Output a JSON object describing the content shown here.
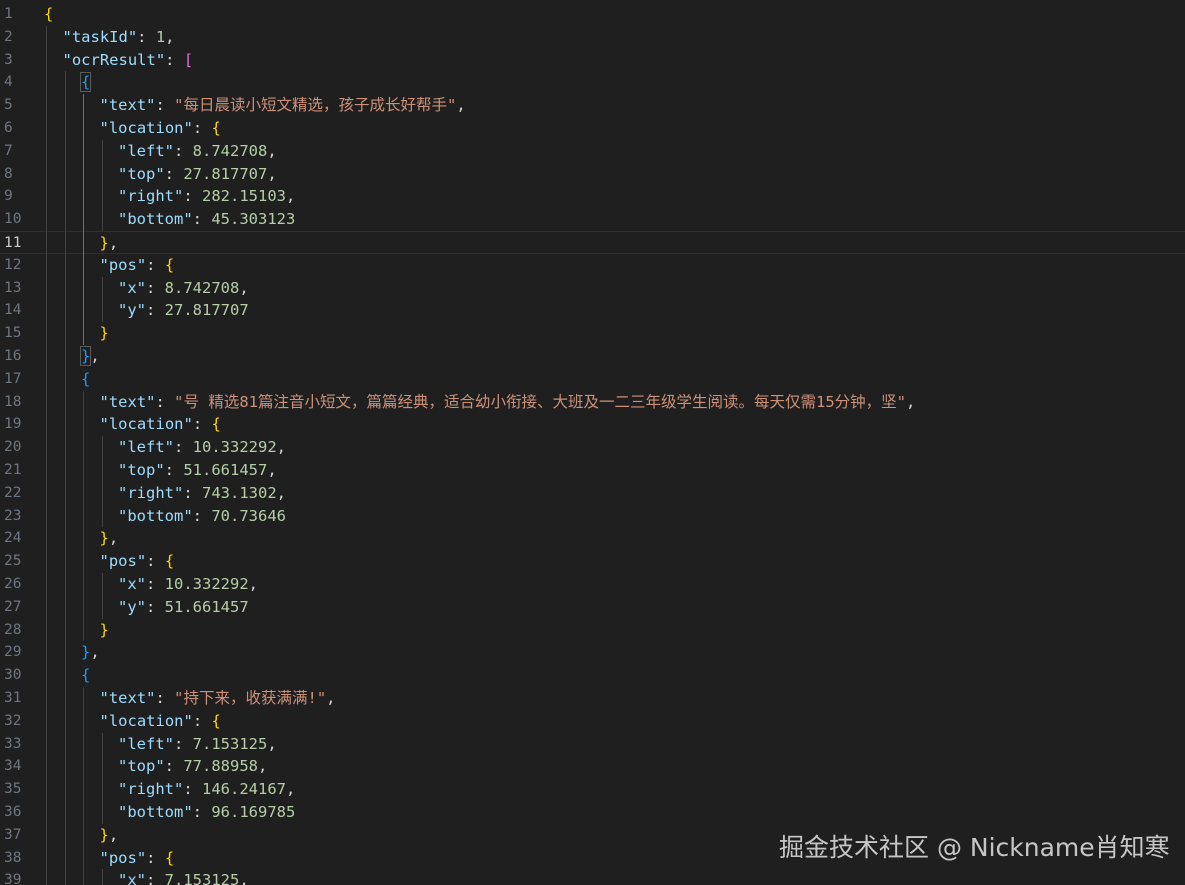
{
  "editor": {
    "theme": {
      "background": "#1f1f1f",
      "key": "#9cdcfe",
      "string": "#ce9178",
      "number": "#b5cea8",
      "bracket_l1": "#ffd700",
      "bracket_l2": "#da70d6",
      "bracket_l3": "#179fff"
    },
    "current_line": 11,
    "lines": [
      {
        "n": "1",
        "code": [
          [
            "b1",
            "{"
          ]
        ]
      },
      {
        "n": "2",
        "code": [
          [
            "k",
            "\"taskId\""
          ],
          [
            "p",
            ": "
          ],
          [
            "n",
            "1"
          ],
          [
            "p",
            ","
          ]
        ]
      },
      {
        "n": "3",
        "code": [
          [
            "k",
            "\"ocrResult\""
          ],
          [
            "p",
            ": "
          ],
          [
            "b2",
            "["
          ]
        ]
      },
      {
        "n": "4",
        "code": [
          [
            "b3 bm",
            "{"
          ]
        ]
      },
      {
        "n": "5",
        "code": [
          [
            "k",
            "\"text\""
          ],
          [
            "p",
            ": "
          ],
          [
            "s",
            "\"每日晨读小短文精选，孩子成长好帮手\""
          ],
          [
            "p",
            ","
          ]
        ]
      },
      {
        "n": "6",
        "code": [
          [
            "k",
            "\"location\""
          ],
          [
            "p",
            ": "
          ],
          [
            "b1",
            "{"
          ]
        ]
      },
      {
        "n": "7",
        "code": [
          [
            "k",
            "\"left\""
          ],
          [
            "p",
            ": "
          ],
          [
            "n",
            "8.742708"
          ],
          [
            "p",
            ","
          ]
        ]
      },
      {
        "n": "8",
        "code": [
          [
            "k",
            "\"top\""
          ],
          [
            "p",
            ": "
          ],
          [
            "n",
            "27.817707"
          ],
          [
            "p",
            ","
          ]
        ]
      },
      {
        "n": "9",
        "code": [
          [
            "k",
            "\"right\""
          ],
          [
            "p",
            ": "
          ],
          [
            "n",
            "282.15103"
          ],
          [
            "p",
            ","
          ]
        ]
      },
      {
        "n": "10",
        "code": [
          [
            "k",
            "\"bottom\""
          ],
          [
            "p",
            ": "
          ],
          [
            "n",
            "45.303123"
          ]
        ]
      },
      {
        "n": "11",
        "code": [
          [
            "b1",
            "}"
          ],
          [
            "p",
            ","
          ]
        ]
      },
      {
        "n": "12",
        "code": [
          [
            "k",
            "\"pos\""
          ],
          [
            "p",
            ": "
          ],
          [
            "b1",
            "{"
          ]
        ]
      },
      {
        "n": "13",
        "code": [
          [
            "k",
            "\"x\""
          ],
          [
            "p",
            ": "
          ],
          [
            "n",
            "8.742708"
          ],
          [
            "p",
            ","
          ]
        ]
      },
      {
        "n": "14",
        "code": [
          [
            "k",
            "\"y\""
          ],
          [
            "p",
            ": "
          ],
          [
            "n",
            "27.817707"
          ]
        ]
      },
      {
        "n": "15",
        "code": [
          [
            "b1",
            "}"
          ]
        ]
      },
      {
        "n": "16",
        "code": [
          [
            "b3 bm",
            "}"
          ],
          [
            "p",
            ","
          ]
        ]
      },
      {
        "n": "17",
        "code": [
          [
            "b3",
            "{"
          ]
        ]
      },
      {
        "n": "18",
        "code": [
          [
            "k",
            "\"text\""
          ],
          [
            "p",
            ": "
          ],
          [
            "s",
            "\"号 精选81篇注音小短文，篇篇经典，适合幼小衔接、大班及一二三年级学生阅读。每天仅需15分钟，坚\""
          ],
          [
            "p",
            ","
          ]
        ]
      },
      {
        "n": "19",
        "code": [
          [
            "k",
            "\"location\""
          ],
          [
            "p",
            ": "
          ],
          [
            "b1",
            "{"
          ]
        ]
      },
      {
        "n": "20",
        "code": [
          [
            "k",
            "\"left\""
          ],
          [
            "p",
            ": "
          ],
          [
            "n",
            "10.332292"
          ],
          [
            "p",
            ","
          ]
        ]
      },
      {
        "n": "21",
        "code": [
          [
            "k",
            "\"top\""
          ],
          [
            "p",
            ": "
          ],
          [
            "n",
            "51.661457"
          ],
          [
            "p",
            ","
          ]
        ]
      },
      {
        "n": "22",
        "code": [
          [
            "k",
            "\"right\""
          ],
          [
            "p",
            ": "
          ],
          [
            "n",
            "743.1302"
          ],
          [
            "p",
            ","
          ]
        ]
      },
      {
        "n": "23",
        "code": [
          [
            "k",
            "\"bottom\""
          ],
          [
            "p",
            ": "
          ],
          [
            "n",
            "70.73646"
          ]
        ]
      },
      {
        "n": "24",
        "code": [
          [
            "b1",
            "}"
          ],
          [
            "p",
            ","
          ]
        ]
      },
      {
        "n": "25",
        "code": [
          [
            "k",
            "\"pos\""
          ],
          [
            "p",
            ": "
          ],
          [
            "b1",
            "{"
          ]
        ]
      },
      {
        "n": "26",
        "code": [
          [
            "k",
            "\"x\""
          ],
          [
            "p",
            ": "
          ],
          [
            "n",
            "10.332292"
          ],
          [
            "p",
            ","
          ]
        ]
      },
      {
        "n": "27",
        "code": [
          [
            "k",
            "\"y\""
          ],
          [
            "p",
            ": "
          ],
          [
            "n",
            "51.661457"
          ]
        ]
      },
      {
        "n": "28",
        "code": [
          [
            "b1",
            "}"
          ]
        ]
      },
      {
        "n": "29",
        "code": [
          [
            "b3",
            "}"
          ],
          [
            "p",
            ","
          ]
        ]
      },
      {
        "n": "30",
        "code": [
          [
            "b3",
            "{"
          ]
        ]
      },
      {
        "n": "31",
        "code": [
          [
            "k",
            "\"text\""
          ],
          [
            "p",
            ": "
          ],
          [
            "s",
            "\"持下来，收获满满!\""
          ],
          [
            "p",
            ","
          ]
        ]
      },
      {
        "n": "32",
        "code": [
          [
            "k",
            "\"location\""
          ],
          [
            "p",
            ": "
          ],
          [
            "b1",
            "{"
          ]
        ]
      },
      {
        "n": "33",
        "code": [
          [
            "k",
            "\"left\""
          ],
          [
            "p",
            ": "
          ],
          [
            "n",
            "7.153125"
          ],
          [
            "p",
            ","
          ]
        ]
      },
      {
        "n": "34",
        "code": [
          [
            "k",
            "\"top\""
          ],
          [
            "p",
            ": "
          ],
          [
            "n",
            "77.88958"
          ],
          [
            "p",
            ","
          ]
        ]
      },
      {
        "n": "35",
        "code": [
          [
            "k",
            "\"right\""
          ],
          [
            "p",
            ": "
          ],
          [
            "n",
            "146.24167"
          ],
          [
            "p",
            ","
          ]
        ]
      },
      {
        "n": "36",
        "code": [
          [
            "k",
            "\"bottom\""
          ],
          [
            "p",
            ": "
          ],
          [
            "n",
            "96.169785"
          ]
        ]
      },
      {
        "n": "37",
        "code": [
          [
            "b1",
            "}"
          ],
          [
            "p",
            ","
          ]
        ]
      },
      {
        "n": "38",
        "code": [
          [
            "k",
            "\"pos\""
          ],
          [
            "p",
            ": "
          ],
          [
            "b1",
            "{"
          ]
        ]
      },
      {
        "n": "39",
        "code": [
          [
            "k",
            "\"x\""
          ],
          [
            "p",
            ": "
          ],
          [
            "n",
            "7.153125"
          ],
          [
            "p",
            ","
          ]
        ]
      }
    ]
  },
  "watermark": "掘金技术社区 @ Nickname肖知寒"
}
